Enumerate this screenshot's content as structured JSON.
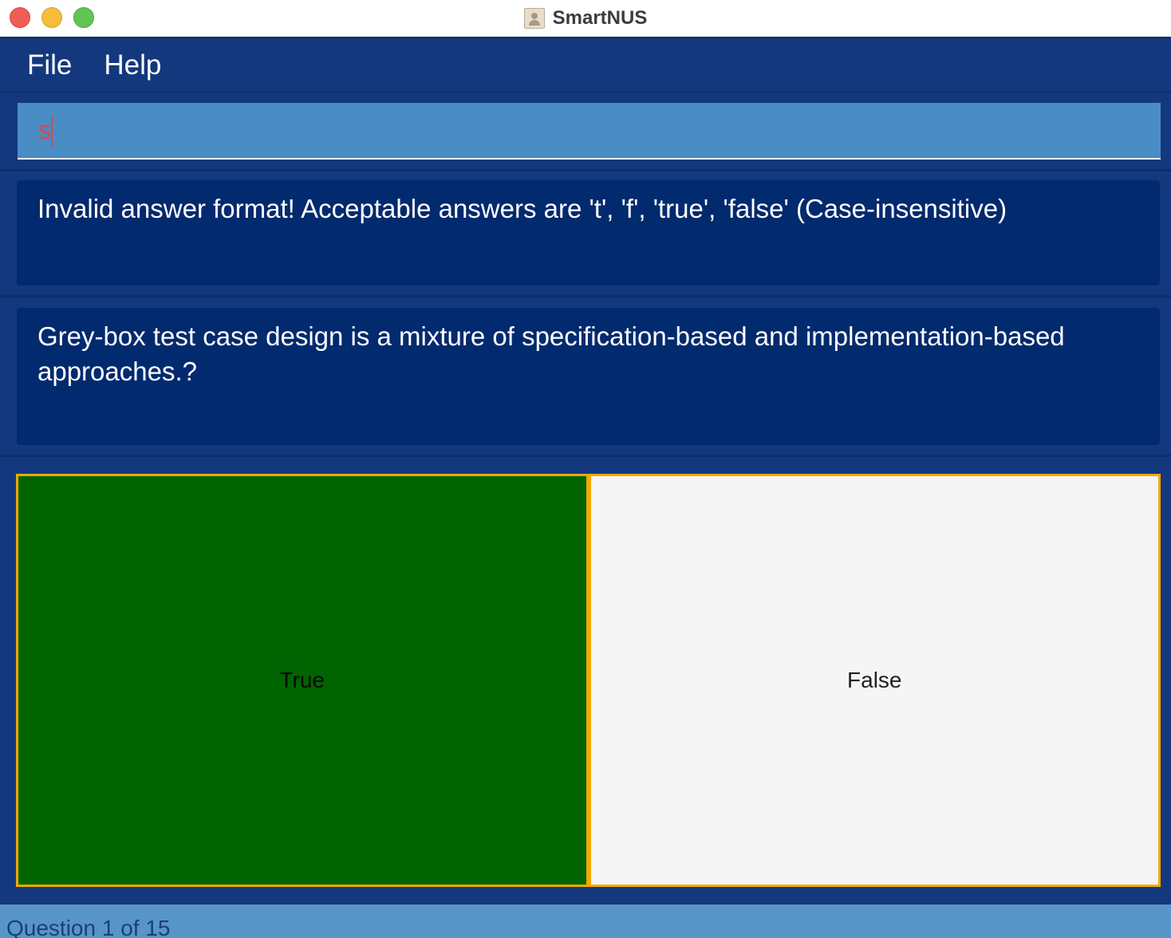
{
  "window": {
    "title": "SmartNUS"
  },
  "menu": {
    "file_label": "File",
    "help_label": "Help"
  },
  "command_box": {
    "value": "s"
  },
  "result_display": {
    "message": "Invalid answer format! Acceptable answers are 't', 'f', 'true', 'false' (Case-insensitive)"
  },
  "question": {
    "text": "Grey-box test case design is a mixture of specification-based and implementation-based approaches.?"
  },
  "options": {
    "true_label": "True",
    "false_label": "False"
  },
  "status": {
    "progress_text": "Question 1 of 15"
  },
  "colors": {
    "background": "#13387e",
    "panel": "#022a6e",
    "command_box": "#4a8cc4",
    "option_border": "#f5a800",
    "true_option": "#006400",
    "false_option": "#f5f5f5",
    "status_bar": "#5795c9"
  },
  "icons": {
    "app_icon": "app-icon",
    "close": "close-icon",
    "minimize": "minimize-icon",
    "maximize": "maximize-icon"
  }
}
